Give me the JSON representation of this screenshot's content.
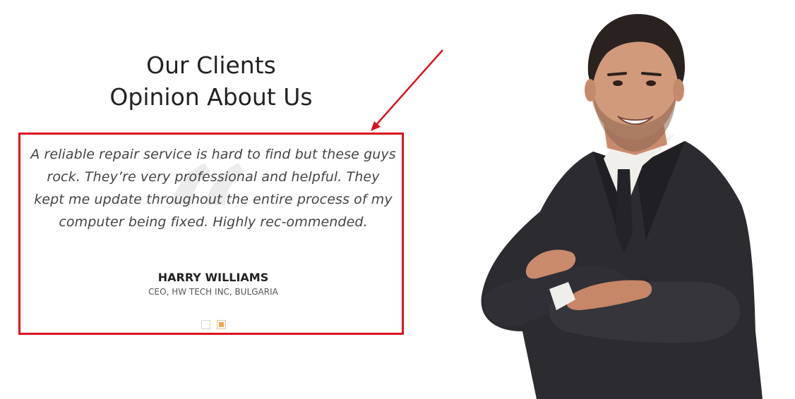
{
  "section": {
    "heading_line1": "Our Clients",
    "heading_line2": "Opinion About Us"
  },
  "testimonial": {
    "quote": "A reliable repair service is hard to find but these guys rock. They’re very professional and helpful. They kept me update throughout the entire process of my computer being fixed. Highly rec-ommended.",
    "author_name": "HARRY WILLIAMS",
    "author_title": "CEO, HW TECH INC, BULGARIA",
    "slides_total": 2,
    "active_slide": 2
  },
  "colors": {
    "highlight_border": "#d9131f",
    "active_dot": "#f2a54a",
    "heading": "#222222",
    "body_text": "#444444"
  },
  "icons": [
    "quote-mark-icon",
    "annotation-arrow"
  ]
}
